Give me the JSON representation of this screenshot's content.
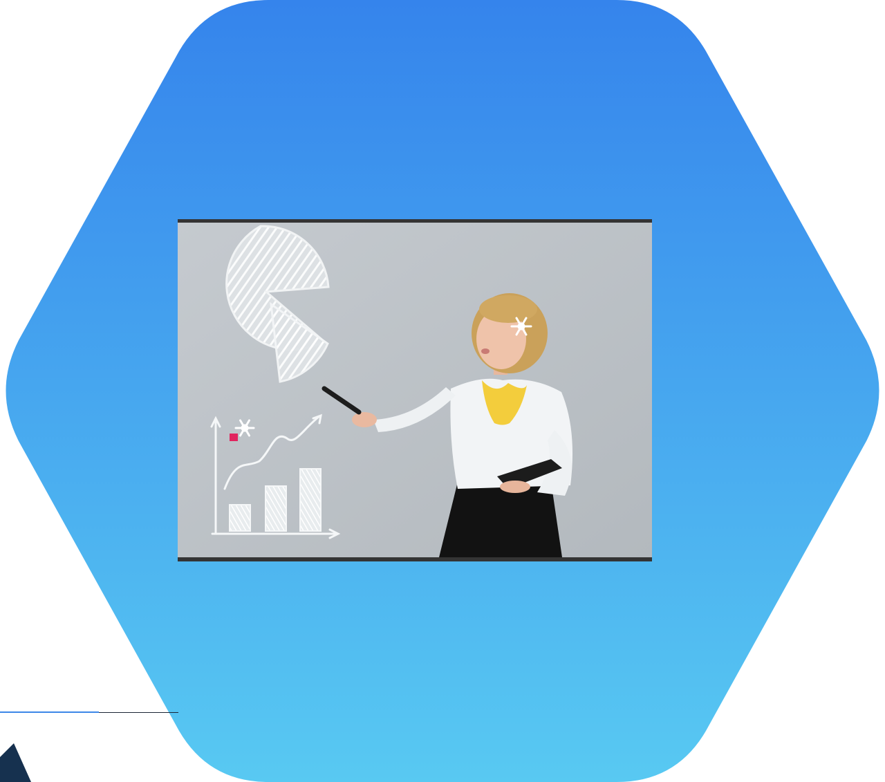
{
  "scene": {
    "background_color": "#ffffff",
    "hexagon_gradient": [
      "#3584ec",
      "#58c9f2"
    ],
    "photo_border_color": "#343434",
    "photo_background_color": "#bcc2c7",
    "accent_blue": "#3b86e8",
    "accent_navy": "#16314f"
  },
  "photo": {
    "subject": "presenter-pointing-at-chalk-charts",
    "chalk_pie_slices": [
      0.86,
      0.14
    ],
    "chalk_bars": [
      0.35,
      0.63,
      0.95
    ]
  },
  "icons": {
    "snowflake": "snowflake-icon",
    "marker": "red-marker-icon"
  }
}
